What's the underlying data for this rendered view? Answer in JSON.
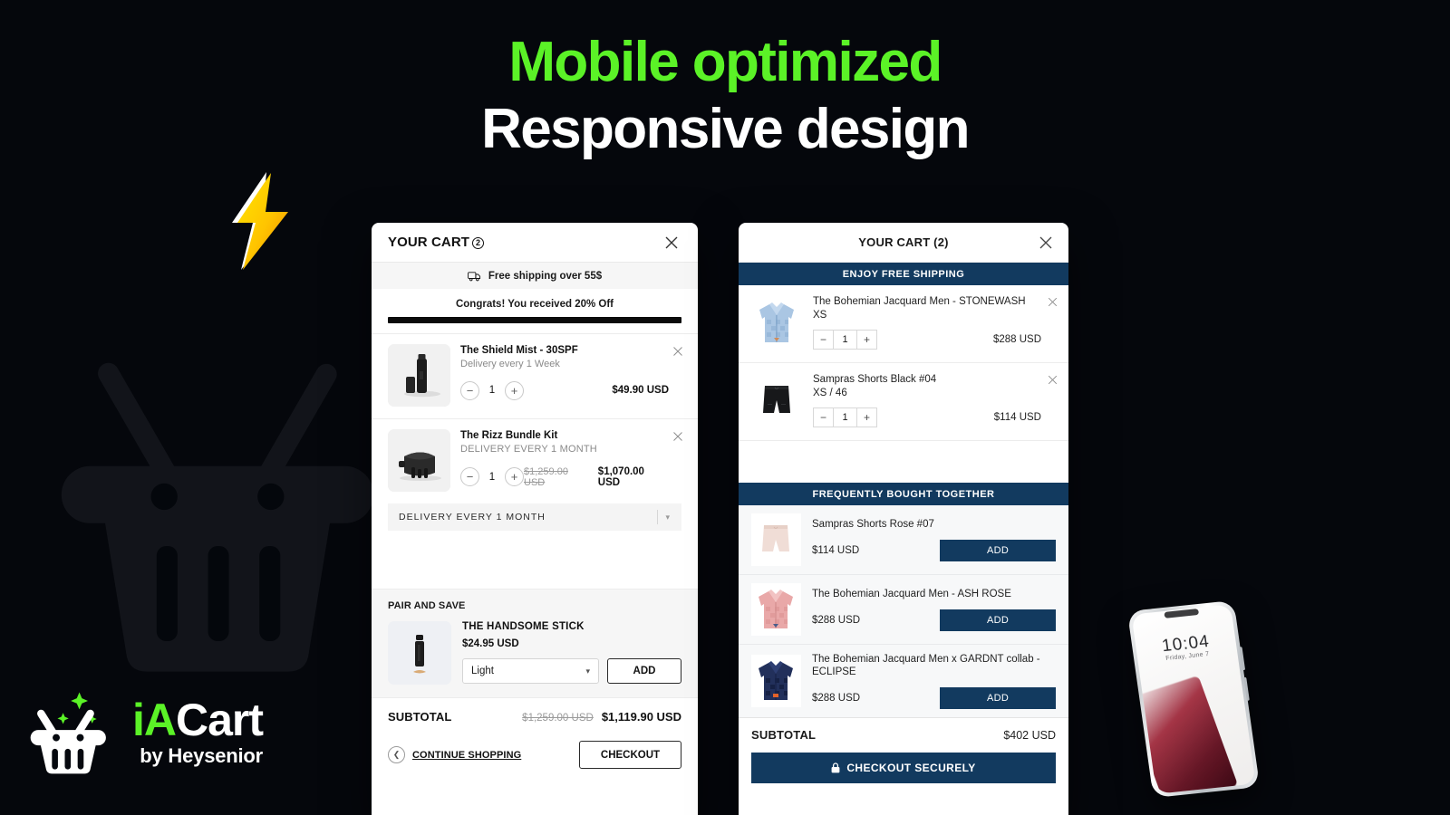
{
  "headline": {
    "line1": "Mobile optimized",
    "line2": "Responsive design",
    "accent_color": "#5bf227"
  },
  "logo": {
    "name_accent": "iA",
    "name_rest": "Cart",
    "tagline": "by Heysenior",
    "accent_color": "#5bf227"
  },
  "phone_mockup": {
    "lock_time": "10:04",
    "lock_date": "Friday, June 7"
  },
  "cart_left": {
    "title": "YOUR CART",
    "badge_count": "2",
    "close_icon": "close-icon",
    "shipping_bar": {
      "icon": "truck-icon",
      "text": "Free shipping over 55$"
    },
    "congrats_text": "Congrats! You received 20% Off",
    "progress_percent": 100,
    "items": [
      {
        "name": "The Shield Mist - 30SPF",
        "subtitle": "Delivery every 1 Week",
        "subtitle_caps": false,
        "quantity": "1",
        "old_price": "",
        "price": "$49.90 USD",
        "thumb": "spray-bottle-thumb"
      },
      {
        "name": "The Rizz Bundle Kit",
        "subtitle": "DELIVERY EVERY 1 MONTH",
        "subtitle_caps": true,
        "quantity": "1",
        "old_price": "$1,259.00 USD",
        "price": "$1,070.00 USD",
        "thumb": "bundle-kit-thumb"
      }
    ],
    "selling_plan": {
      "label": "DELIVERY EVERY 1 MONTH",
      "caret_icon": "chevron-down-icon"
    },
    "pair_and_save": {
      "title": "PAIR AND SAVE",
      "product_name": "THE HANDSOME STICK",
      "product_price": "$24.95 USD",
      "variant_selected": "Light",
      "add_label": "ADD",
      "thumb": "handsome-stick-thumb"
    },
    "subtotal": {
      "label": "SUBTOTAL",
      "old_value": "$1,259.00 USD",
      "value": "$1,119.90 USD"
    },
    "continue_shopping": "CONTINUE SHOPPING",
    "checkout_label": "CHECKOUT"
  },
  "cart_right": {
    "title": "YOUR CART (2)",
    "close_icon": "close-icon",
    "accent_color": "#123a5f",
    "free_shipping_bar": "ENJOY FREE SHIPPING",
    "items": [
      {
        "name": "The Bohemian Jacquard Men - STONEWASH",
        "variant": "XS",
        "quantity": "1",
        "price": "$288 USD",
        "thumb": "blue-camp-shirt-thumb"
      },
      {
        "name": "Sampras Shorts Black #04",
        "variant": "XS / 46",
        "quantity": "1",
        "price": "$114 USD",
        "thumb": "black-shorts-thumb"
      }
    ],
    "fbt_bar": "FREQUENTLY BOUGHT TOGETHER",
    "fbt_items": [
      {
        "name": "Sampras Shorts Rose #07",
        "price": "$114 USD",
        "add_label": "ADD",
        "thumb": "rose-shorts-thumb"
      },
      {
        "name": "The Bohemian Jacquard Men - ASH ROSE",
        "price": "$288 USD",
        "add_label": "ADD",
        "thumb": "pink-camp-shirt-thumb"
      },
      {
        "name": "The Bohemian Jacquard Men x GARDNT collab - ECLIPSE",
        "price": "$288 USD",
        "add_label": "ADD",
        "thumb": "navy-camp-shirt-thumb"
      }
    ],
    "subtotal": {
      "label": "SUBTOTAL",
      "value": "$402 USD"
    },
    "checkout_label": "CHECKOUT SECURELY",
    "checkout_icon": "lock-icon"
  },
  "decor": {
    "bolt_icon": "lightning-bolt-icon",
    "watermark_icon": "shopping-basket-watermark"
  }
}
